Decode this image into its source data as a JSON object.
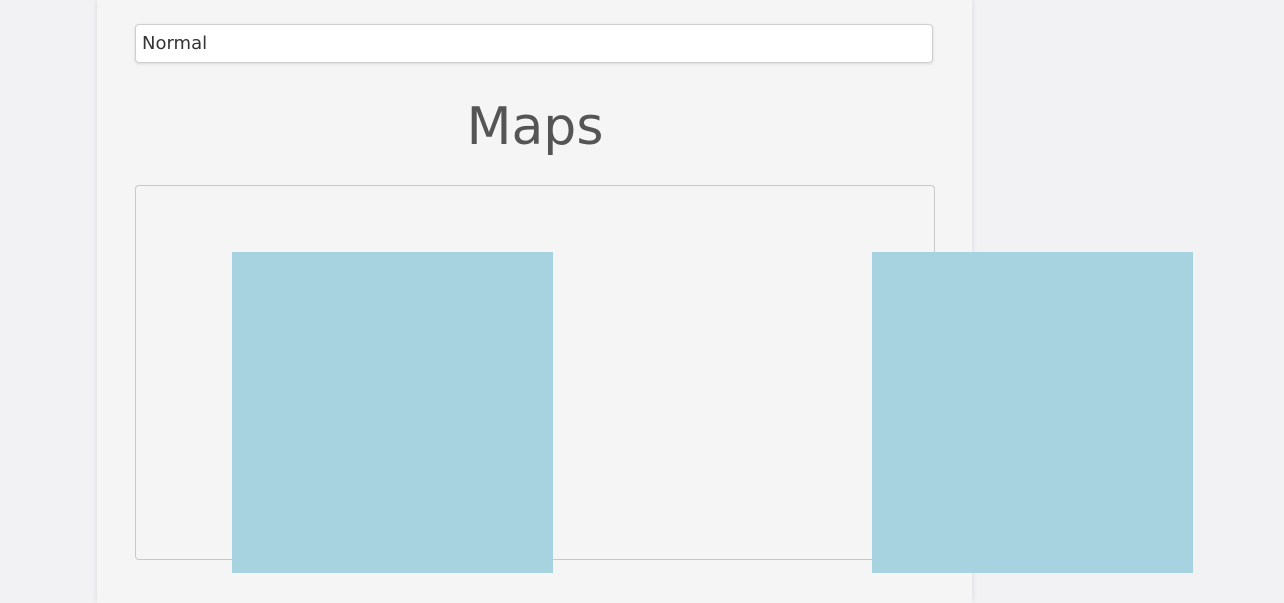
{
  "style_selector": {
    "value": "Normal"
  },
  "page": {
    "title": "Maps"
  },
  "map": {
    "tile_color": "#a6d3df"
  },
  "colors": {
    "page_background": "#f2f2f5",
    "panel_background": "#f5f5f5"
  }
}
